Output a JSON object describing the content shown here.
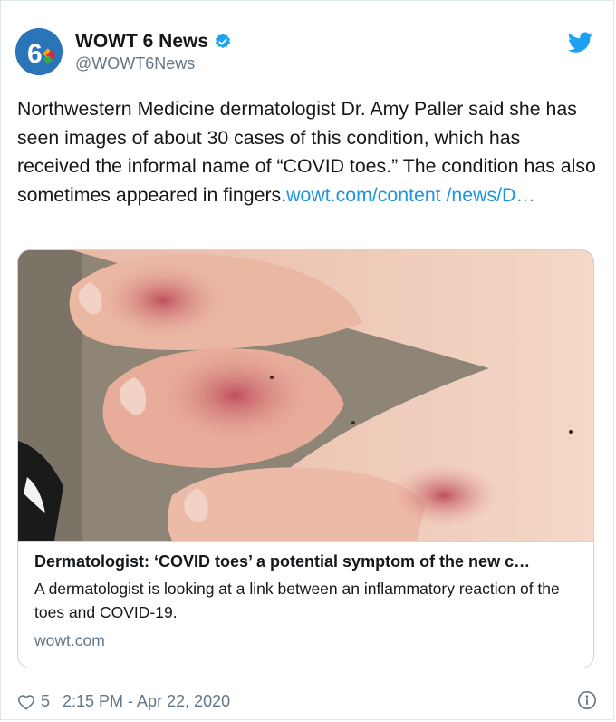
{
  "tweet": {
    "author_name": "WOWT 6 News",
    "author_handle": "@WOWT6News",
    "body_text": "Northwestern Medicine dermatologist Dr. Amy Paller said she has seen images of about 30 cases of this condition, which has received the informal name of “COVID toes.” The condition has also sometimes appeared in fingers.",
    "body_link": "wowt.com/content /news/D…"
  },
  "card": {
    "title": "Dermatologist: ‘COVID toes’ a potential symptom of the new c…",
    "description": "A dermatologist is looking at a link between an inflammatory reaction of the toes and COVID-19.",
    "domain": "wowt.com"
  },
  "footer": {
    "likes": "5",
    "timestamp": "2:15 PM - Apr 22, 2020"
  },
  "icons": {
    "verified": "verified-badge-icon",
    "brand": "twitter-bird-icon",
    "like": "heart-icon",
    "info": "info-icon"
  },
  "colors": {
    "link": "#1b95e0",
    "brand_blue": "#1da1f2",
    "muted": "#657786"
  }
}
